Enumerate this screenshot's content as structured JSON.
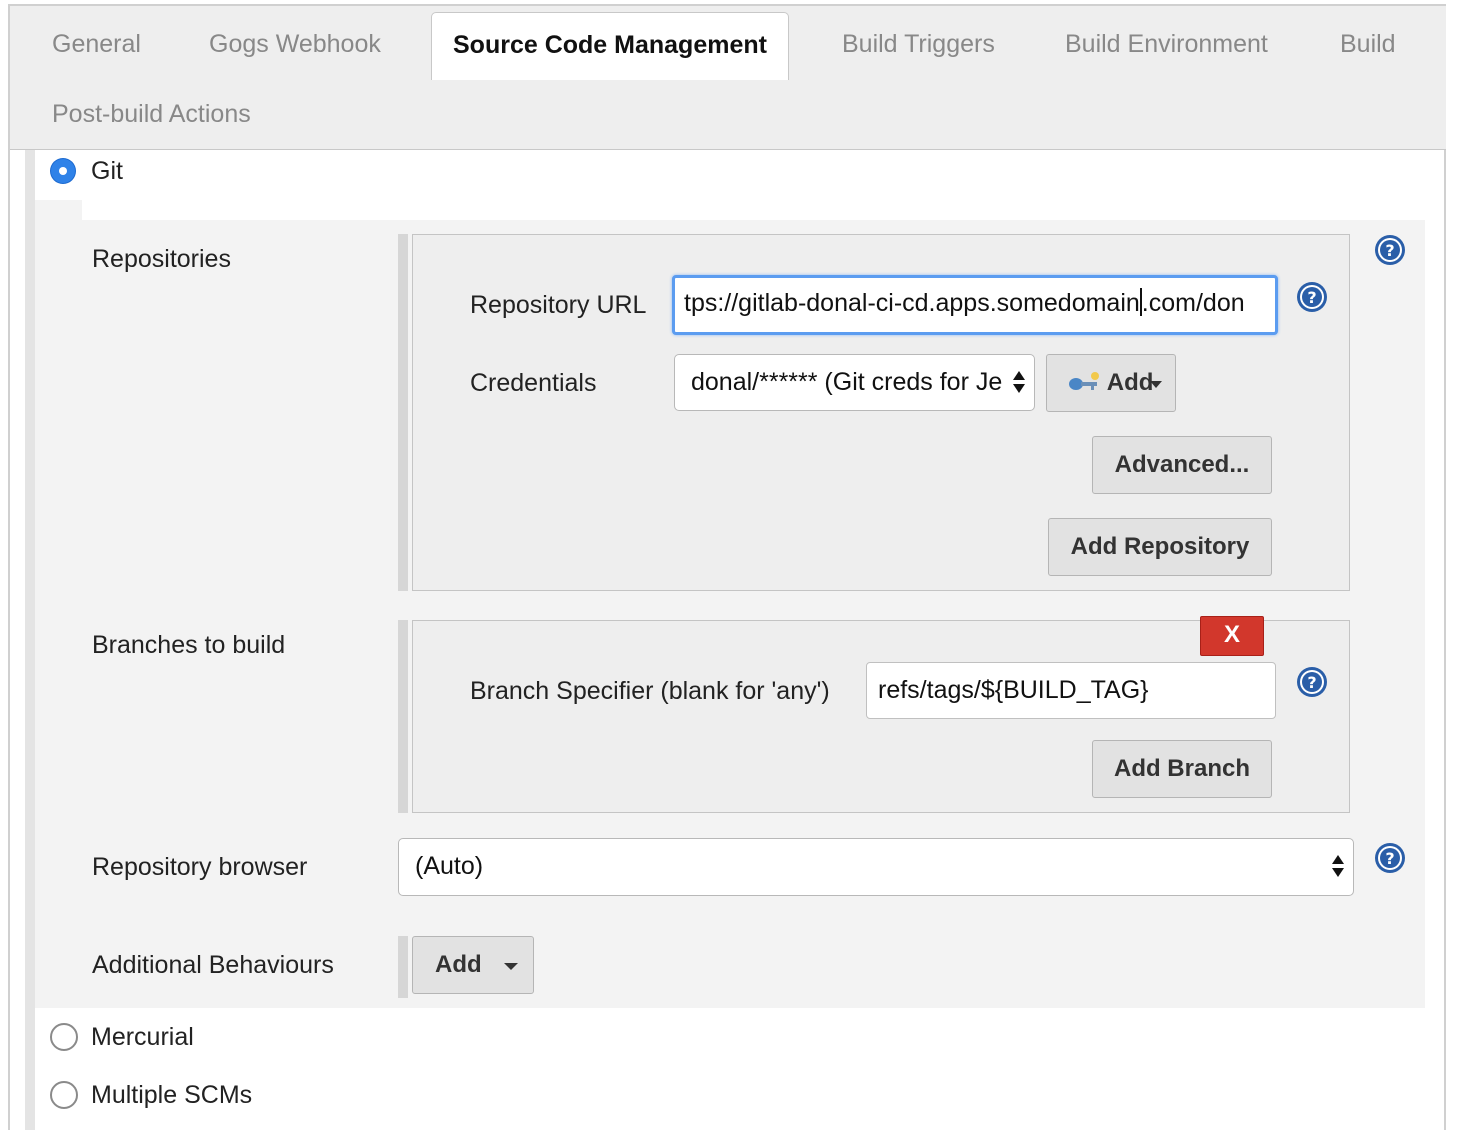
{
  "tabs": [
    {
      "label": "General"
    },
    {
      "label": "Gogs Webhook"
    },
    {
      "label": "Source Code Management",
      "active": true
    },
    {
      "label": "Build Triggers"
    },
    {
      "label": "Build Environment"
    },
    {
      "label": "Build"
    },
    {
      "label": "Post-build Actions"
    }
  ],
  "scm": {
    "options": [
      {
        "label": "Git",
        "selected": true
      },
      {
        "label": "Mercurial",
        "selected": false
      },
      {
        "label": "Multiple SCMs",
        "selected": false
      }
    ]
  },
  "git": {
    "repositories_label": "Repositories",
    "repository_url_label": "Repository URL",
    "repository_url_before_cursor": "tps://gitlab-donal-ci-cd.apps.somedomain",
    "repository_url_after_cursor": ".com/don",
    "credentials_label": "Credentials",
    "credentials_value": "donal/****** (Git creds for Je",
    "credentials_add_button": "Add",
    "advanced_button": "Advanced...",
    "add_repository_button": "Add Repository",
    "branches_label": "Branches to build",
    "delete_branch_button": "X",
    "branch_specifier_label": "Branch Specifier (blank for 'any')",
    "branch_specifier_value": "refs/tags/${BUILD_TAG}",
    "add_branch_button": "Add Branch",
    "repository_browser_label": "Repository browser",
    "repository_browser_value": "(Auto)",
    "additional_behaviours_label": "Additional Behaviours",
    "additional_behaviours_button": "Add"
  },
  "colors": {
    "accent": "#2f82e8",
    "help_icon": "#2a5ea8",
    "delete_button": "#d2372c"
  },
  "icons": {
    "help": "help-icon",
    "key": "key-icon",
    "dropdown": "caret-down-icon",
    "select_arrows": "select-updown-icon"
  }
}
